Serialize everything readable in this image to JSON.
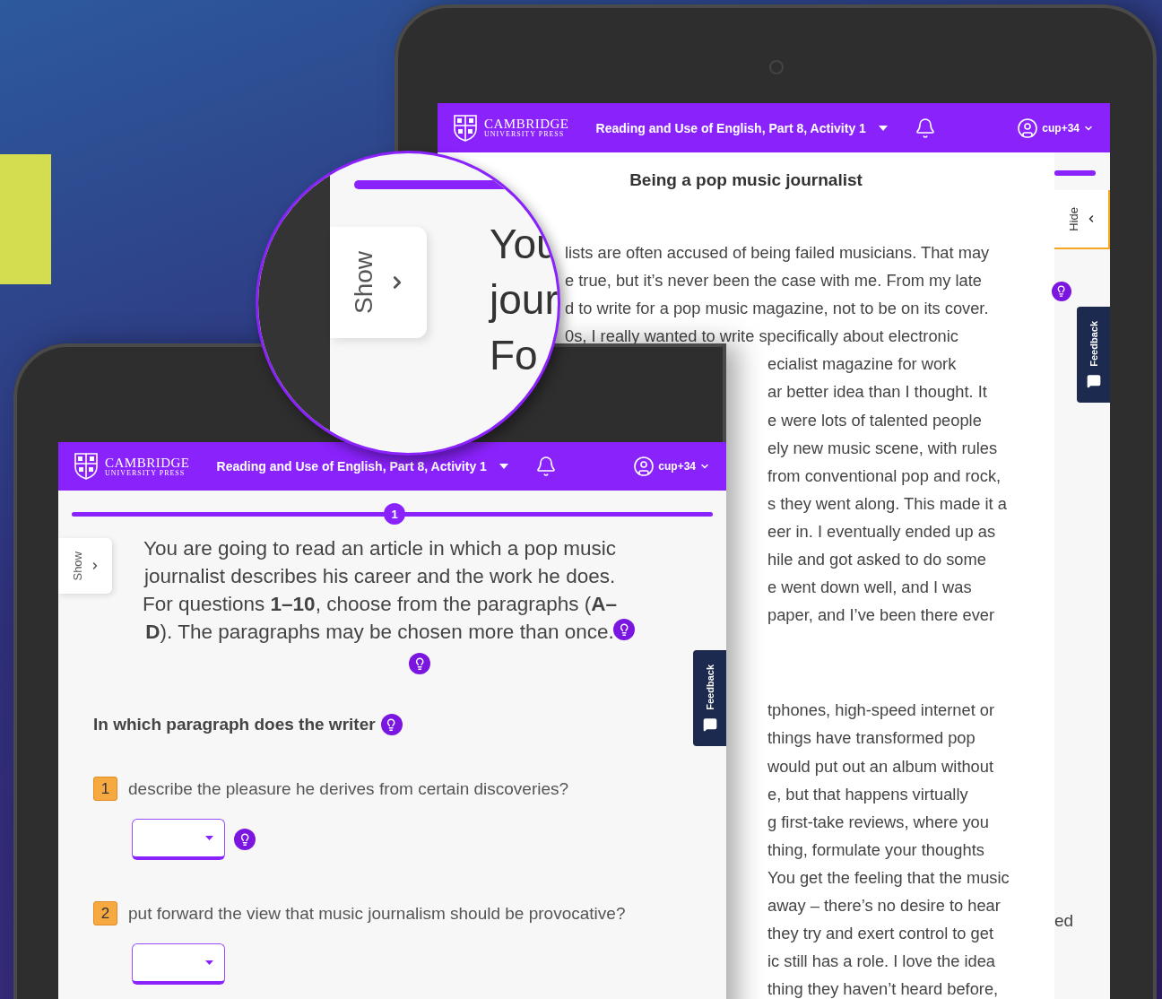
{
  "back_tablet": {
    "header": {
      "brand": "CAMBRIDGE",
      "brand_sub": "UNIVERSITY PRESS",
      "activity": "Reading and Use of English, Part 8, Activity 1",
      "user": "cup+34"
    },
    "title": "Being a pop music journalist",
    "article_top": [
      "lists are often accused of being failed musicians. That may",
      "e true, but it’s never been the case with me. From my late",
      "d to write for a pop music magazine, not to be on its cover.",
      "0s, I really wanted to write specifically about electronic"
    ],
    "article_middle": [
      "ecialist magazine for work",
      "ar better idea than I thought. It",
      "e were lots of talented people",
      "ely new music scene, with rules",
      "from conventional pop and rock,",
      "s they went along. This made it a",
      "eer in. I eventually ended up as",
      "hile and got asked to do some",
      "e went down well, and I was",
      "paper, and I’ve been there ever"
    ],
    "article_bottom": [
      "tphones, high-speed internet or",
      "things have transformed pop",
      "would put out an album without",
      "e, but that happens virtually",
      "g first-take reviews, where you",
      "thing, formulate your thoughts",
      "You get the feeling that the music",
      "away – there’s no desire to hear",
      "they try and exert control to get",
      "ic still has a role. I love the idea",
      "thing they haven’t heard before,"
    ],
    "hide_tab": "Hide",
    "feedback_tab": "Feedback",
    "side_text": "ed",
    "progress": {
      "level": 1
    }
  },
  "magnifier": {
    "show_tab": "Show",
    "fragments": [
      "You",
      "jour",
      "Fo"
    ],
    "progress": {
      "level": 1
    }
  },
  "front_tablet": {
    "header": {
      "brand": "CAMBRIDGE",
      "brand_sub": "UNIVERSITY PRESS",
      "activity": "Reading and Use of English, Part 8, Activity 1",
      "user": "cup+34"
    },
    "step": "1",
    "show_tab": "Show",
    "progress": {
      "level": 1
    },
    "instructions": [
      "You are going to read an article in which a pop music",
      "journalist describes his career and the work he does.",
      "For questions **1–10**, choose from the paragraphs (**A–**",
      "**D**). The paragraphs may be chosen more than once."
    ],
    "question_stem": "In which paragraph does the writer",
    "questions": [
      {
        "number": "1",
        "text": "describe the pleasure he derives from certain discoveries?",
        "hint": true
      },
      {
        "number": "2",
        "text": "put forward the view that music journalism should be provocative?",
        "hint": false
      }
    ],
    "feedback_tab": "Feedback"
  }
}
